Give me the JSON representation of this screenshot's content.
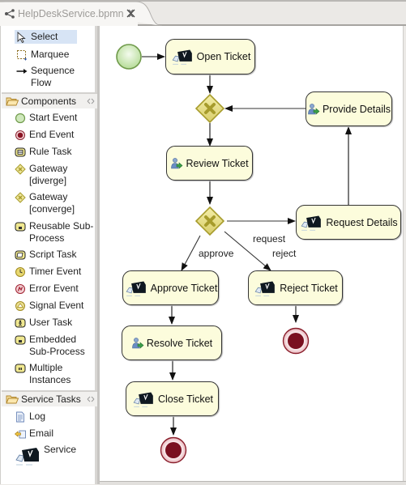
{
  "editor": {
    "tab": {
      "title": "HelpDeskService.bpmn",
      "icon": "bpmn-process-icon",
      "close_icon": "close-icon"
    }
  },
  "palette": {
    "tools": [
      {
        "label": "Select",
        "icon": "arrow-pointer-icon",
        "selected": true
      },
      {
        "label": "Marquee",
        "icon": "marquee-icon"
      },
      {
        "label_line1": "Sequence",
        "label_line2": "Flow",
        "icon": "connection-arrow-icon"
      }
    ],
    "drawers": [
      {
        "label": "Components",
        "icon": "folder-open-icon",
        "items": [
          {
            "label": "Start Event",
            "icon": "start-event-icon"
          },
          {
            "label": "End Event",
            "icon": "end-event-icon"
          },
          {
            "label": "Rule Task",
            "icon": "rule-task-icon"
          },
          {
            "label_line1": "Gateway",
            "label_line2": "[diverge]",
            "icon": "gateway-icon"
          },
          {
            "label_line1": "Gateway",
            "label_line2": "[converge]",
            "icon": "gateway-icon"
          },
          {
            "label_line1": "Reusable Sub-",
            "label_line2": "Process",
            "icon": "subprocess-icon"
          },
          {
            "label": "Script Task",
            "icon": "script-task-icon"
          },
          {
            "label": "Timer Event",
            "icon": "timer-event-icon"
          },
          {
            "label": "Error Event",
            "icon": "error-event-icon"
          },
          {
            "label": "Signal Event",
            "icon": "signal-event-icon"
          },
          {
            "label": "User Task",
            "icon": "user-task-icon"
          },
          {
            "label_line1": "Embedded",
            "label_line2": "Sub-Process",
            "icon": "subprocess-icon"
          },
          {
            "label_line1": "Multiple",
            "label_line2": "Instances",
            "icon": "multiple-instances-icon"
          }
        ]
      },
      {
        "label": "Service Tasks",
        "icon": "folder-open-icon",
        "items": [
          {
            "label": "Log",
            "icon": "log-document-icon"
          },
          {
            "label": "Email",
            "icon": "email-icon"
          },
          {
            "label": "Service",
            "icon": "service-task-icon"
          }
        ]
      }
    ]
  },
  "diagram": {
    "nodes": {
      "open_ticket": "Open Ticket",
      "review_ticket": "Review Ticket",
      "provide_details": "Provide Details",
      "request_details": "Request Details",
      "approve_ticket": "Approve Ticket",
      "reject_ticket": "Reject Ticket",
      "resolve_ticket": "Resolve Ticket",
      "close_ticket": "Close Ticket"
    },
    "flow_labels": {
      "request": "request",
      "approve": "approve",
      "reject": "reject"
    },
    "colors": {
      "task_fill": "#fcfcdc",
      "gateway_fill": "#e2dc8a",
      "gateway_stroke": "#a79c2c",
      "start_fill": "#c8e4b0",
      "start_stroke": "#6f9a4a",
      "end_fill": "#7a1020",
      "end_ring": "#f0c8cc"
    }
  }
}
